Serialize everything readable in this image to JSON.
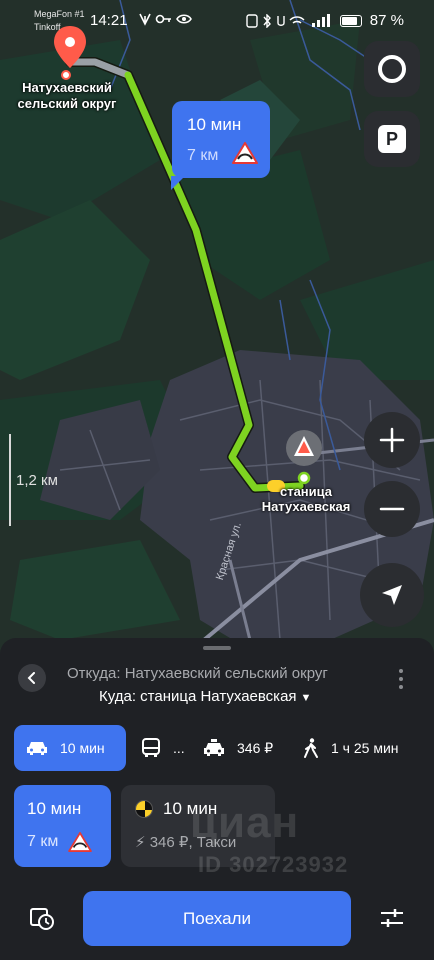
{
  "status_bar": {
    "carrier_line1": "MegaFon #1",
    "carrier_line2": "Tinkoff",
    "time": "14:21",
    "battery_percent": "87 %",
    "battery_level": 0.87
  },
  "map": {
    "origin_label": "Натухаевский сельский округ",
    "destination_label": "станица Натухаевская",
    "route_bubble": {
      "time": "10 мин",
      "distance": "7 км"
    },
    "scale_label": "1,2 км",
    "street_label": "Красная ул.",
    "colors": {
      "route": "#7ed321",
      "accent": "#3f74ef",
      "origin_pin": "#ff5b4a"
    }
  },
  "controls": {
    "alice_icon": "alice-ring-icon",
    "parking_label": "P",
    "zoom_in_icon": "plus-icon",
    "zoom_out_icon": "minus-icon",
    "locate_icon": "navigation-arrow-icon"
  },
  "route_panel": {
    "from": "Откуда: Натухаевский сельский округ",
    "to": "Куда: станица Натухаевская",
    "modes": {
      "car_time": "10 мин",
      "transit_time": "...",
      "taxi_price": "346 ₽",
      "walk_time": "1 ч 25 мин"
    },
    "options": {
      "car_time": "10 мин",
      "car_distance": "7 км",
      "taxi_time": "10 мин",
      "taxi_price": "346 ₽, Такси"
    },
    "watermark_brand": "циан",
    "watermark_id": "ID 302723932",
    "go_label": "Поехали"
  }
}
